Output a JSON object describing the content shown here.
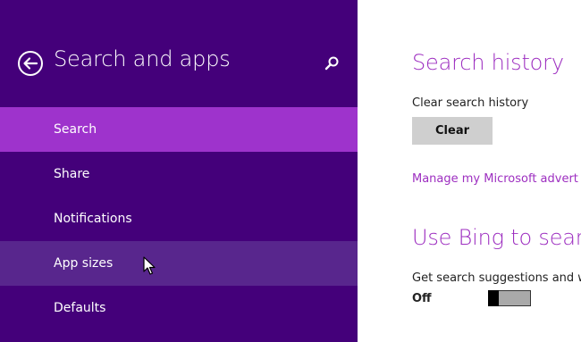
{
  "sidebar": {
    "title": "Search and apps",
    "back_icon": "back-arrow-icon",
    "search_icon": "search-icon",
    "items": [
      {
        "label": "Search",
        "state": "selected"
      },
      {
        "label": "Share",
        "state": "normal"
      },
      {
        "label": "Notifications",
        "state": "normal"
      },
      {
        "label": "App sizes",
        "state": "hover"
      },
      {
        "label": "Defaults",
        "state": "normal"
      }
    ]
  },
  "main": {
    "search_history": {
      "heading": "Search history",
      "clear_label": "Clear search history",
      "clear_button": "Clear"
    },
    "manage_link": "Manage my Microsoft advert",
    "bing": {
      "heading": "Use Bing to searc",
      "suggestions_label": "Get search suggestions and w",
      "toggle_state": "Off"
    }
  },
  "colors": {
    "sidebar_bg": "#44007a",
    "selected_bg": "#9e33cc",
    "hover_bg": "#58268d",
    "accent": "#9d2ec0",
    "button_bg": "#cfcfcf"
  }
}
